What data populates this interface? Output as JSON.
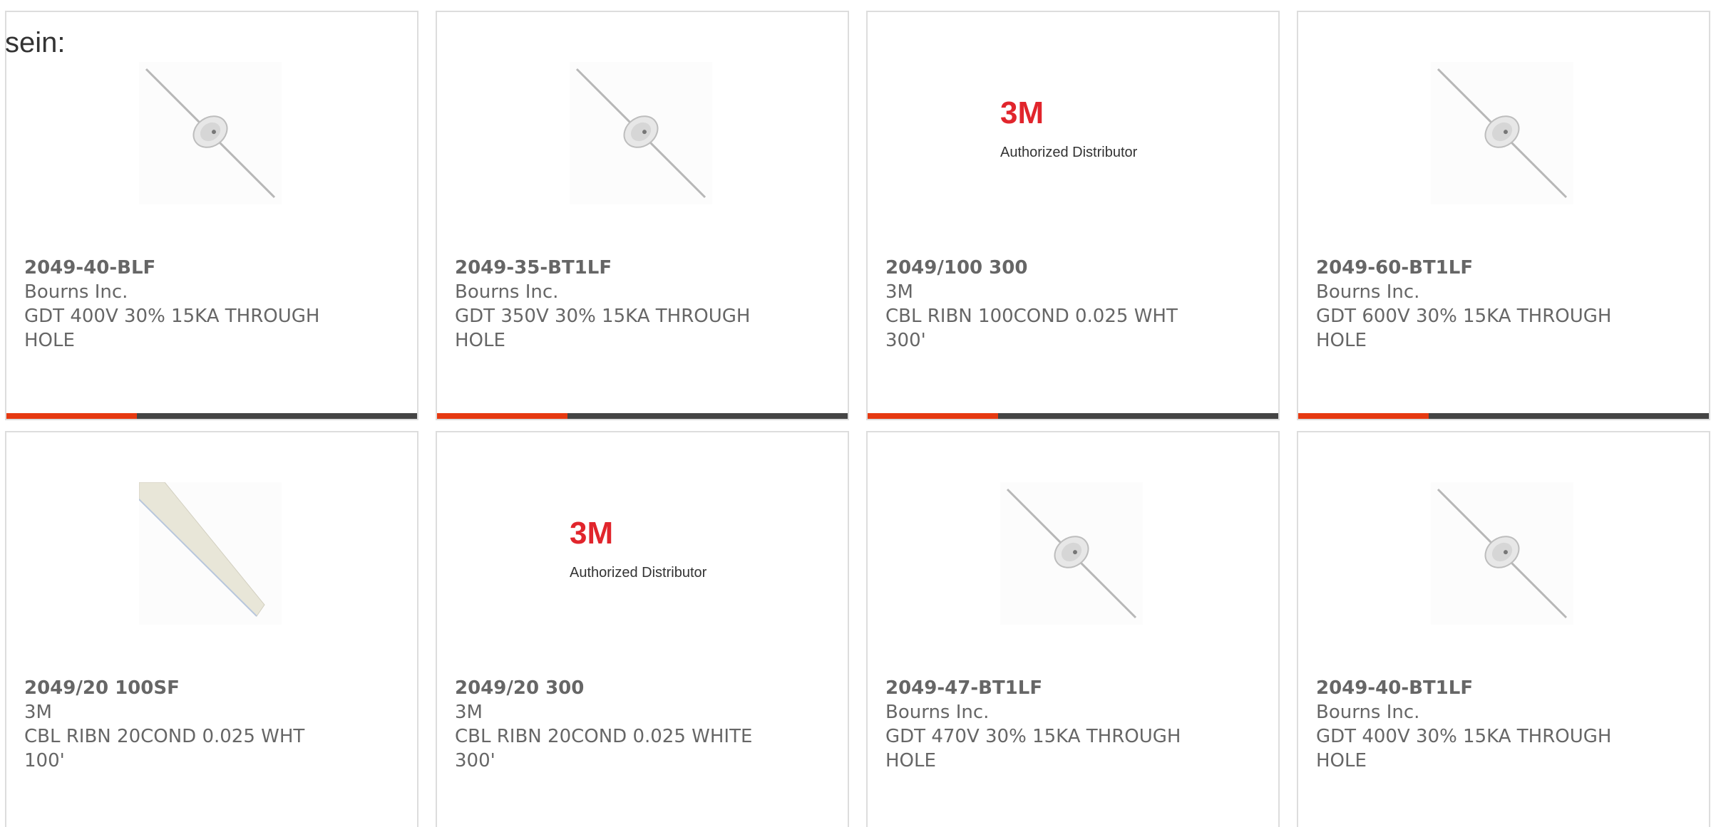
{
  "page": {
    "prefix_text": "sein:"
  },
  "products": [
    {
      "part_number": "2049-40-BLF",
      "manufacturer": "Bourns Inc.",
      "description": "GDT 400V 30% 15KA THROUGH HOLE",
      "image": "gas-discharge-tube-image"
    },
    {
      "part_number": "2049-35-BT1LF",
      "manufacturer": "Bourns Inc.",
      "description": "GDT 350V 30% 15KA THROUGH HOLE",
      "image": "gas-discharge-tube-image"
    },
    {
      "part_number": "2049/100 300",
      "manufacturer": "3M",
      "description": "CBL RIBN 100COND 0.025 WHT 300'",
      "image": "3m-authorized-distributor-logo",
      "logo_text": "3M",
      "logo_caption": "Authorized Distributor"
    },
    {
      "part_number": "2049-60-BT1LF",
      "manufacturer": "Bourns Inc.",
      "description": "GDT 600V 30% 15KA THROUGH HOLE",
      "image": "gas-discharge-tube-image"
    },
    {
      "part_number": "2049/20 100SF",
      "manufacturer": "3M",
      "description": "CBL RIBN 20COND 0.025 WHT 100'",
      "image": "ribbon-cable-image"
    },
    {
      "part_number": "2049/20 300",
      "manufacturer": "3M",
      "description": "CBL RIBN 20COND 0.025 WHITE 300'",
      "image": "3m-authorized-distributor-logo",
      "logo_text": "3M",
      "logo_caption": "Authorized Distributor"
    },
    {
      "part_number": "2049-47-BT1LF",
      "manufacturer": "Bourns Inc.",
      "description": "GDT 470V 30% 15KA THROUGH HOLE",
      "image": "gas-discharge-tube-image"
    },
    {
      "part_number": "2049-40-BT1LF",
      "manufacturer": "Bourns Inc.",
      "description": "GDT 400V 30% 15KA THROUGH HOLE",
      "image": "gas-discharge-tube-image"
    }
  ],
  "colors": {
    "accent": "#e63911",
    "bar": "#444444",
    "text": "#666666",
    "border": "#dddddd",
    "logo_red": "#e1252c"
  }
}
